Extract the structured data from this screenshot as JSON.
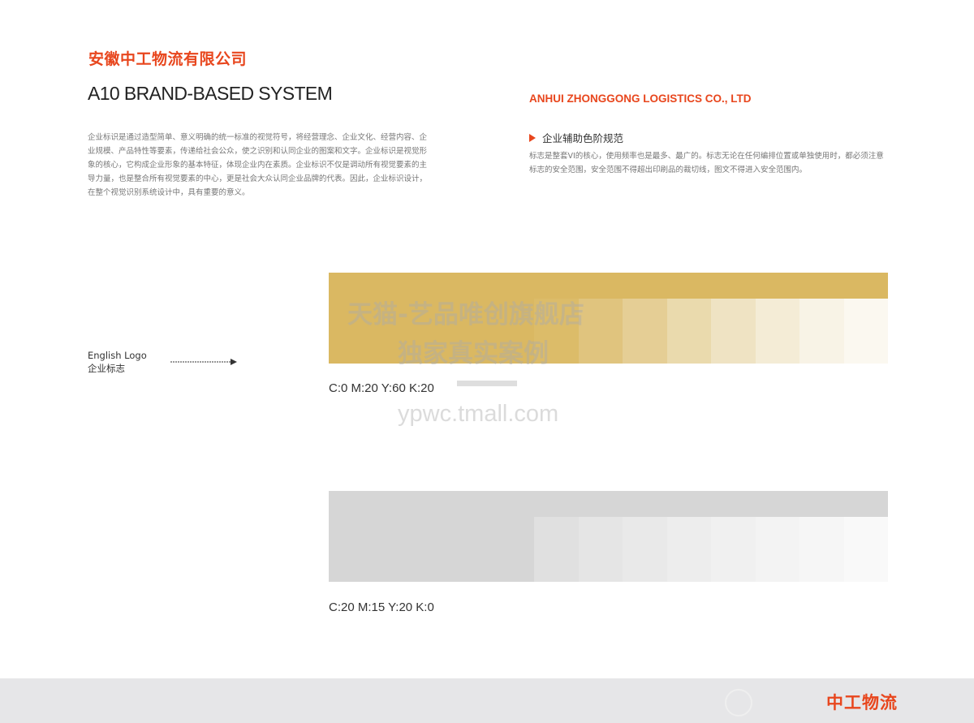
{
  "header": {
    "company_cn": "安徽中工物流有限公司",
    "system_title": "A10  BRAND-BASED SYSTEM",
    "company_en": "ANHUI ZHONGGONG LOGISTICS CO., LTD",
    "intro": "企业标识是通过造型简单、意义明确的统一标准的视觉符号，将经营理念、企业文化、经营内容、企业规模、产品特性等要素，传递给社会公众，使之识别和认同企业的图案和文字。企业标识是视觉形象的核心，它构成企业形象的基本特征，体现企业内在素质。企业标识不仅是调动所有视觉要素的主导力量，也是整合所有视觉要素的中心，更是社会大众认同企业品牌的代表。因此，企业标识设计，在整个视觉识别系统设计中，具有重要的意义。"
  },
  "section": {
    "title": "企业辅助色阶规范",
    "description": "标志是整套VI的核心，使用频率也是最多、最广的。标志无论在任何编排位置或单独使用时，都必须注意标志的安全范围，安全范围不得超出印刷品的裁切线，图文不得进入安全范围内。"
  },
  "logo_label": {
    "line1": "English Logo",
    "line2": "企业标志"
  },
  "palettes": [
    {
      "formula": "C:0 M:20 Y:60 K:20",
      "base_color": "#dab862",
      "steps": [
        "#dcbc69",
        "#e0c47e",
        "#e5ce95",
        "#eadaad",
        "#efe3c3",
        "#f4ecd6",
        "#f8f3e6",
        "#fbf8f0"
      ]
    },
    {
      "formula": "C:20 M:15 Y:20 K:0",
      "base_color": "#d6d6d6",
      "steps": [
        "#e0e0e0",
        "#e5e5e5",
        "#e9e9e9",
        "#ededed",
        "#f0f0f0",
        "#f3f3f3",
        "#f6f6f6",
        "#f9f9f9"
      ]
    }
  ],
  "watermark": {
    "line1": "天猫-艺品唯创旗舰店",
    "line2": "独家真实案例",
    "line3": "ypwc.tmall.com"
  },
  "footer": {
    "brand": "中工物流"
  },
  "colors": {
    "accent": "#e8461d",
    "footer_bg": "#e6e6e8"
  }
}
